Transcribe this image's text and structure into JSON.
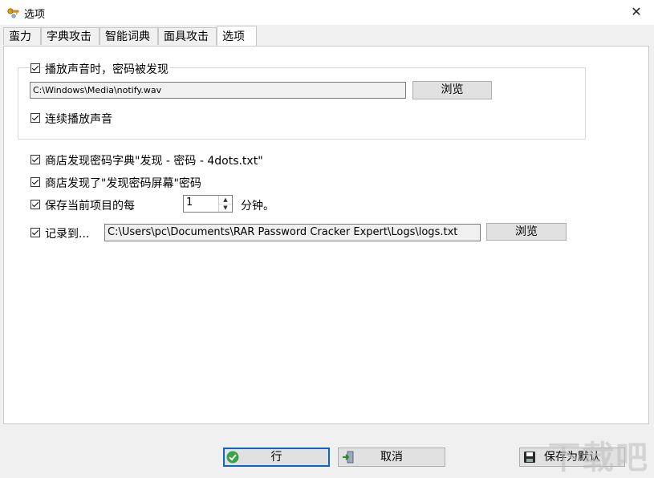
{
  "window": {
    "title": "选项",
    "close_glyph": "✕"
  },
  "tabs": [
    {
      "label": "蛮力"
    },
    {
      "label": "字典攻击"
    },
    {
      "label": "智能词典"
    },
    {
      "label": "面具攻击"
    },
    {
      "label": "选项",
      "active": true
    }
  ],
  "sound": {
    "play_sound_label": "播放声音时，密码被发现",
    "play_sound_checked": true,
    "sound_file_path": "C:\\Windows\\Media\\notify.wav",
    "browse_label": "浏览",
    "loop_label": "连续播放声音",
    "loop_checked": true
  },
  "options": {
    "store_dict_label": "商店发现密码字典\"发现 - 密码 - 4dots.txt\"",
    "store_dict_checked": true,
    "store_screen_label": "商店发现了\"发现密码屏幕\"密码",
    "store_screen_checked": true,
    "save_every_label": "保存当前项目的每",
    "save_every_checked": true,
    "save_every_value": "1",
    "save_every_unit": "分钟。",
    "log_label": "记录到...",
    "log_checked": true,
    "log_path": "C:\\Users\\pc\\Documents\\RAR Password Cracker Expert\\Logs\\logs.txt",
    "log_browse_label": "浏览"
  },
  "footer": {
    "ok_label": "行",
    "cancel_label": "取消",
    "save_default_label": "保存为默认"
  },
  "watermark": "下载吧",
  "icons": [
    "app-icon",
    "close-icon",
    "check-icon",
    "exit-icon",
    "floppy-disk-icon",
    "spin-up-icon",
    "spin-down-icon"
  ],
  "colors": {
    "ok_icon": "#3aa34a",
    "save_icon": "#2a2a2a",
    "window_bg": "#f0f0f0",
    "panel_bg": "#ffffff"
  }
}
